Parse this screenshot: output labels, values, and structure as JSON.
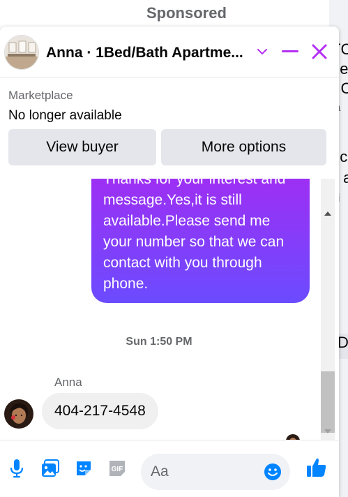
{
  "background": {
    "sponsored_label": "Sponsored",
    "right_edge_fragments": [
      "TC",
      "ge",
      "- C",
      "ta",
      "d",
      "t c",
      "y a",
      "ai",
      "D"
    ]
  },
  "header": {
    "title": "Anna · 1Bed/Bath Apartme...",
    "icons": [
      "chevron-down-icon",
      "minimize-icon",
      "close-icon"
    ],
    "accent_color": "#b430f4"
  },
  "listing": {
    "section_label": "Marketplace",
    "status": "No longer available",
    "buttons": {
      "view_buyer": "View buyer",
      "more_options": "More options"
    }
  },
  "conversation": {
    "outgoing_message": "Thanks for your interest and message.Yes,it is still available.Please send me your number so that we can contact with you through phone.",
    "timestamp": "Sun 1:50 PM",
    "sender_name": "Anna",
    "incoming_message": "404-217-4548"
  },
  "composer": {
    "placeholder": "Aa",
    "icons": [
      "microphone-icon",
      "photo-icon",
      "sticker-icon",
      "gif-icon",
      "emoji-icon",
      "thumbs-up-icon"
    ],
    "gif_label": "GIF",
    "icon_color": "#0084ff"
  }
}
